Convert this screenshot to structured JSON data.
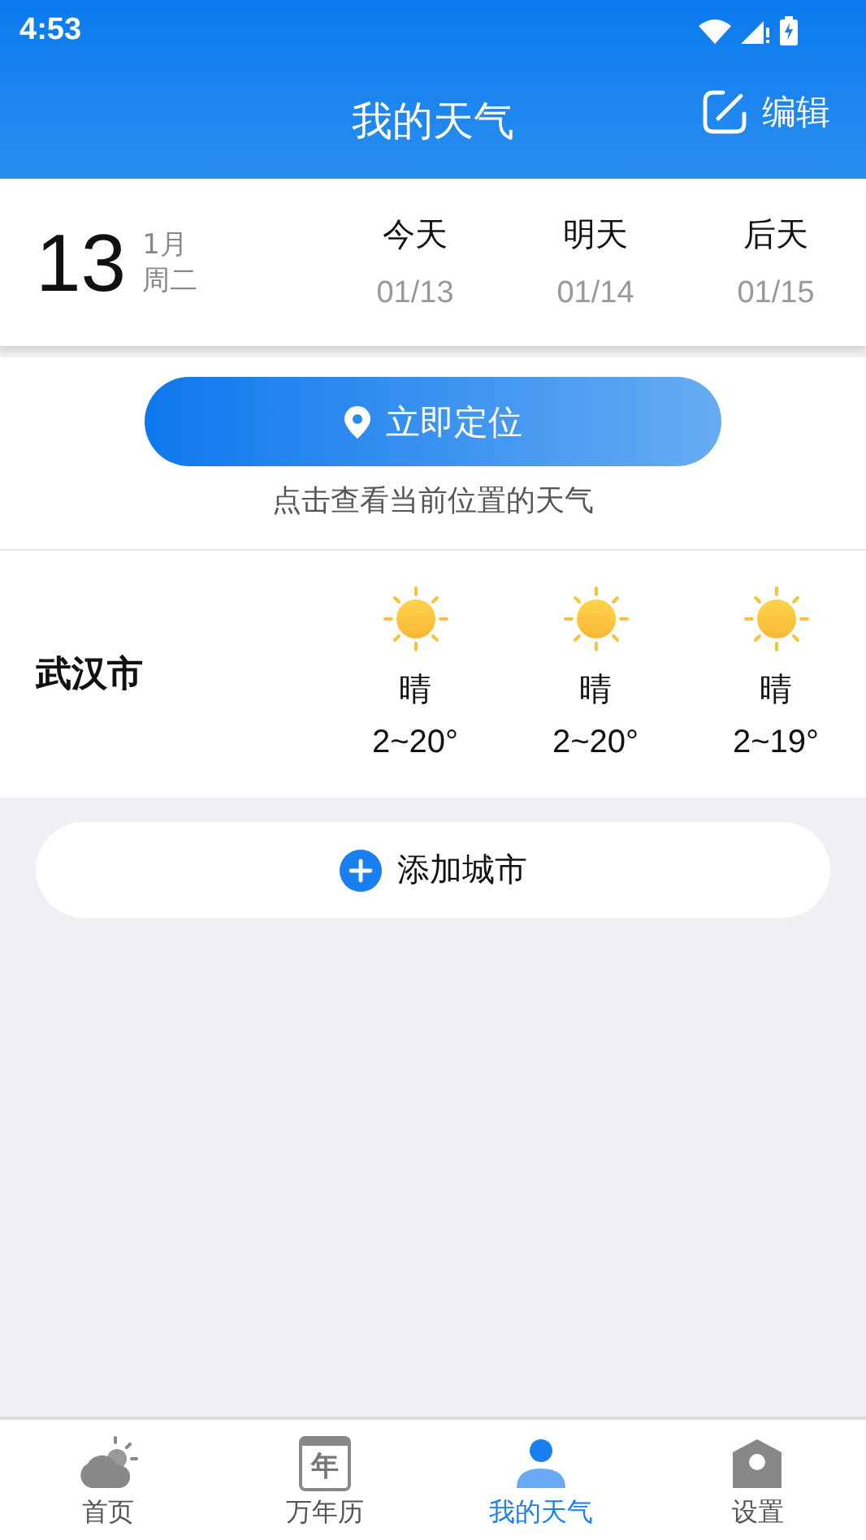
{
  "status_bar": {
    "time": "4:53"
  },
  "header": {
    "title": "我的天气",
    "action": "编辑"
  },
  "date": {
    "day": "13",
    "month": "1月",
    "weekday": "周二"
  },
  "days": [
    {
      "label": "今天",
      "date": "01/13"
    },
    {
      "label": "明天",
      "date": "01/14"
    },
    {
      "label": "后天",
      "date": "01/15"
    }
  ],
  "locate": {
    "button": "立即定位",
    "hint": "点击查看当前位置的天气"
  },
  "cities": [
    {
      "name": "武汉市",
      "forecast": [
        {
          "kind": "sun",
          "condition": "晴",
          "range": "2~20°"
        },
        {
          "kind": "sun",
          "condition": "晴",
          "range": "2~20°"
        },
        {
          "kind": "sun",
          "condition": "晴",
          "range": "2~19°"
        }
      ]
    }
  ],
  "add_city": "添加城市",
  "nav": [
    {
      "kind": "cloud",
      "label": "首页",
      "selected": false
    },
    {
      "kind": "calendar",
      "label": "万年历",
      "icon_text": "年",
      "selected": false
    },
    {
      "kind": "person",
      "label": "我的天气",
      "selected": true
    },
    {
      "kind": "house",
      "label": "设置",
      "selected": false
    }
  ]
}
